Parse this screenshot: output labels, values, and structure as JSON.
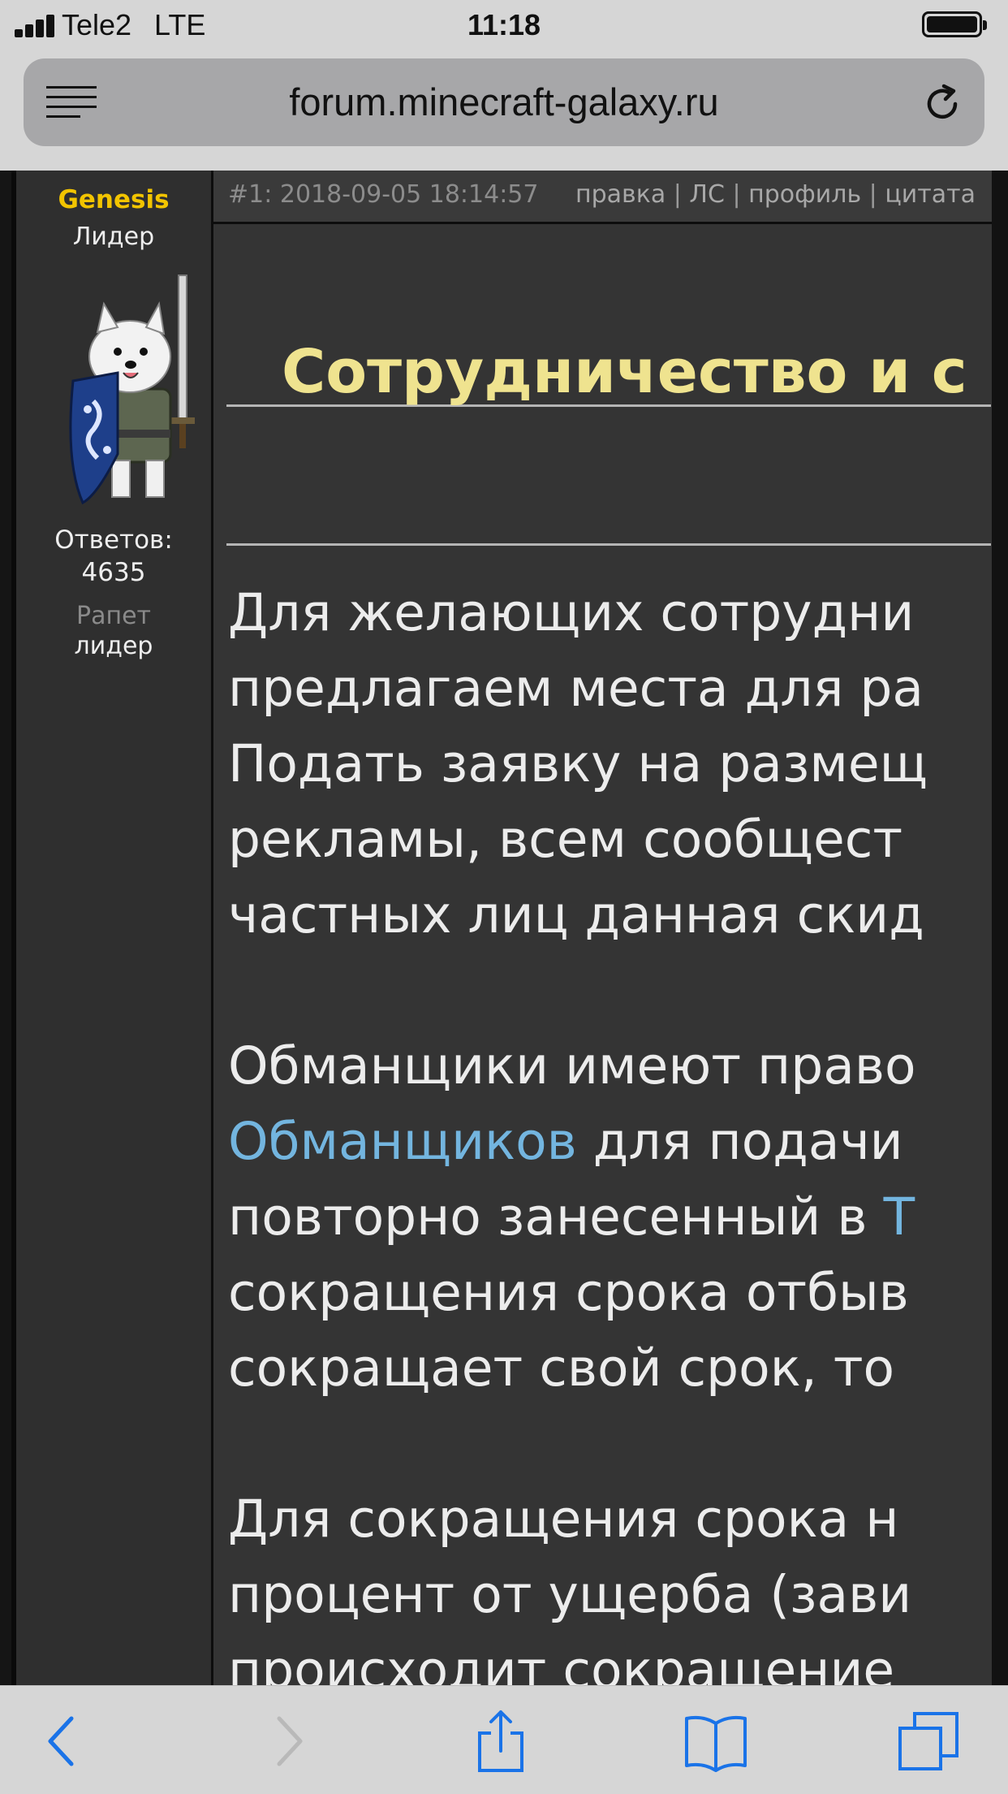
{
  "status_bar": {
    "carrier": "Tele2",
    "network": "LTE",
    "time": "11:18"
  },
  "browser": {
    "url": "forum.minecraft-galaxy.ru",
    "icons": {
      "menu": "hamburger-menu-icon",
      "reload": "reload-icon",
      "back": "back-chevron-icon",
      "forward": "forward-chevron-icon",
      "share": "share-icon",
      "bookmarks": "bookmarks-icon",
      "tabs": "tabs-icon"
    },
    "accent_color": "#1a73e8"
  },
  "post": {
    "author": {
      "username": "Genesis",
      "rank": "Лидер",
      "answers_label": "Ответов:",
      "answers_count": "4635",
      "rating_label": "Рапет",
      "rating_value": "лидер"
    },
    "header": {
      "number_date": "#1: 2018-09-05 18:14:57",
      "actions": [
        "правка",
        "ЛС",
        "профиль",
        "цитата"
      ],
      "separator": " | "
    },
    "title": "Сотрудничество и с",
    "paragraphs": [
      [
        "Для желающих сотрудни",
        "предлагаем места для ра",
        "Подать заявку на размещ",
        "рекламы, всем сообщест",
        "частных лиц данная скид"
      ],
      [
        "Обманщики имеют право"
      ],
      [
        "Для сокращения срока н",
        "процент от ущерба (зави",
        "происходит сокращение"
      ]
    ],
    "paragraph2_link": "Обманщиков",
    "paragraph2_after_link": " для подачи",
    "paragraph2_rest": [
      "повторно занесенный в ",
      "сокращения срока отбыв",
      "сокращает свой срок, то"
    ],
    "paragraph2_trailing_link": "Т",
    "colors": {
      "username": "#f2c400",
      "title": "#efe38f",
      "link": "#73b5df"
    }
  }
}
